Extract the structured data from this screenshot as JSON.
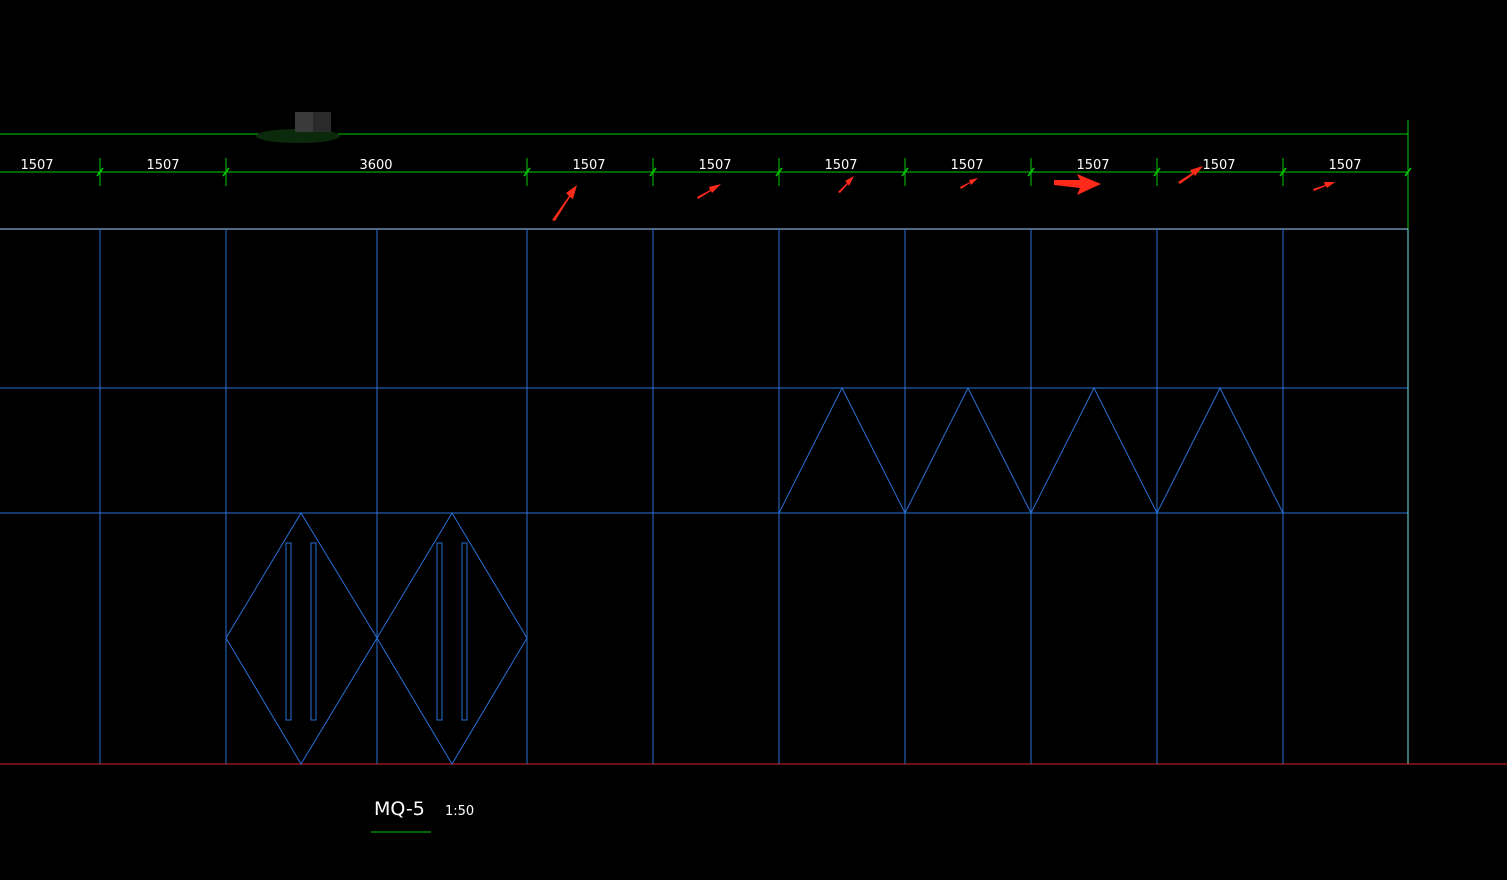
{
  "drawing": {
    "title": "MQ-5",
    "scale": "1:50",
    "colors": {
      "background": "#000000",
      "dimension": "#00cc00",
      "text": "#ffffff",
      "grid": "#2a6fd6",
      "top_edge": "#9fd0ff",
      "right_edge": "#6fe8e8",
      "ground": "#e02020",
      "annotation": "#ff2a1a"
    }
  },
  "dimensions": [
    {
      "label": "1507"
    },
    {
      "label": "1507"
    },
    {
      "label": "3600"
    },
    {
      "label": "1507"
    },
    {
      "label": "1507"
    },
    {
      "label": "1507"
    },
    {
      "label": "1507"
    },
    {
      "label": "1507"
    },
    {
      "label": "1507"
    },
    {
      "label": "1507"
    }
  ],
  "annotations": {
    "arrow_count": 7,
    "icon": "red-arrow-icon"
  }
}
